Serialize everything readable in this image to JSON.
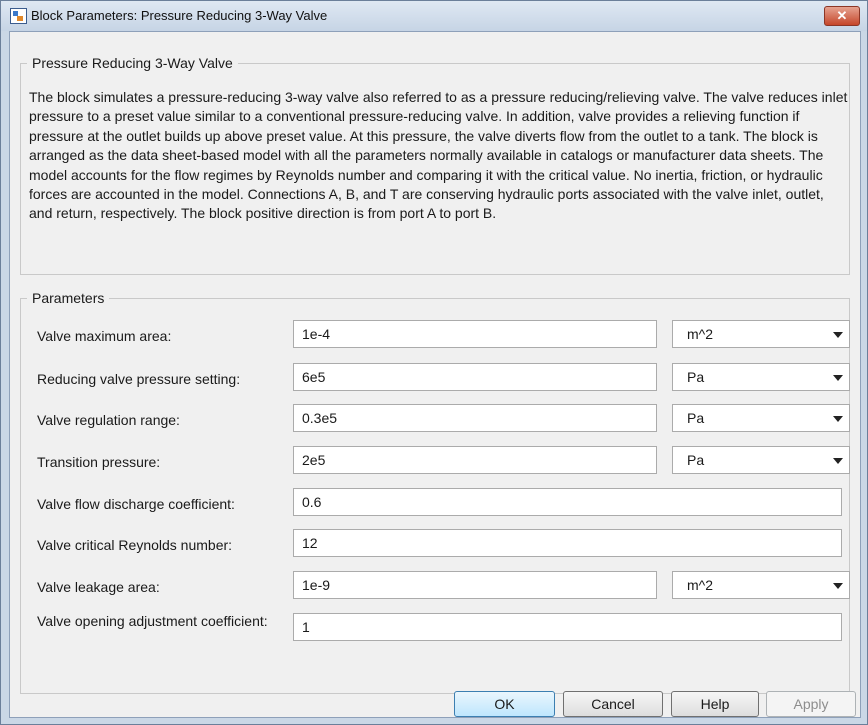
{
  "window": {
    "title": "Block Parameters: Pressure Reducing 3-Way Valve",
    "close_label": "✕"
  },
  "description": {
    "legend": "Pressure Reducing 3-Way Valve",
    "text": "The block simulates a pressure-reducing 3-way valve also referred to as a pressure reducing/relieving valve. The valve reduces inlet pressure to a preset value similar to a conventional pressure-reducing valve. In addition, valve provides a relieving function if pressure at the outlet builds up above preset value. At this pressure, the valve diverts flow from the outlet to a tank. The block is arranged as the data sheet-based model with all the parameters normally available in catalogs or manufacturer data sheets. The model accounts for the flow regimes by Reynolds number and comparing it with the critical value. No inertia, friction, or hydraulic forces are accounted in the model. Connections A, B, and T are conserving hydraulic ports associated with the valve inlet, outlet, and return, respectively. The block positive direction is from port A to port B."
  },
  "parameters": {
    "legend": "Parameters",
    "items": [
      {
        "label": "Valve maximum area:",
        "value": "1e-4",
        "unit": "m^2"
      },
      {
        "label": "Reducing valve pressure setting:",
        "value": "6e5",
        "unit": "Pa"
      },
      {
        "label": "Valve regulation range:",
        "value": "0.3e5",
        "unit": "Pa"
      },
      {
        "label": "Transition pressure:",
        "value": "2e5",
        "unit": "Pa"
      },
      {
        "label": "Valve flow discharge coefficient:",
        "value": "0.6"
      },
      {
        "label": "Valve critical Reynolds number:",
        "value": "12"
      },
      {
        "label": "Valve leakage area:",
        "value": "1e-9",
        "unit": "m^2"
      },
      {
        "label": "Valve opening adjustment coefficient:",
        "value": "1"
      }
    ]
  },
  "buttons": {
    "ok": "OK",
    "cancel": "Cancel",
    "help": "Help",
    "apply": "Apply"
  }
}
